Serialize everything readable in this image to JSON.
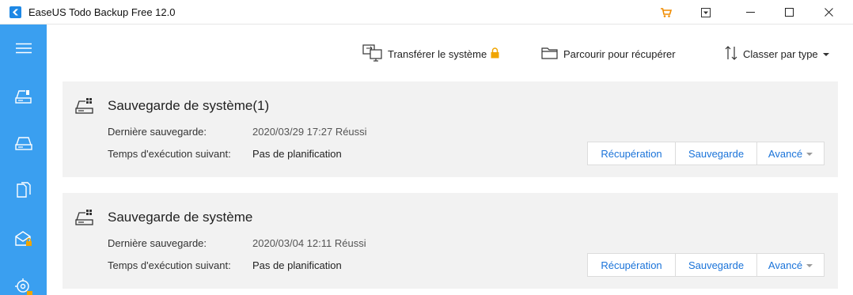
{
  "window": {
    "title": "EaseUS Todo Backup Free 12.0"
  },
  "toolbar": {
    "transfer_label": "Transférer le système",
    "browse_label": "Parcourir pour récupérer",
    "sort_label": "Classer par type"
  },
  "backups": [
    {
      "title": "Sauvegarde de système(1)",
      "last_backup_label": "Dernière sauvegarde:",
      "last_backup_value": "2020/03/29 17:27 Réussi",
      "next_run_label": "Temps d'exécution suivant:",
      "next_run_value": "Pas de planification",
      "recover_label": "Récupération",
      "backup_label": "Sauvegarde",
      "advanced_label": "Avancé"
    },
    {
      "title": "Sauvegarde de système",
      "last_backup_label": "Dernière sauvegarde:",
      "last_backup_value": "2020/03/04 12:11 Réussi",
      "next_run_label": "Temps d'exécution suivant:",
      "next_run_value": "Pas de planification",
      "recover_label": "Récupération",
      "backup_label": "Sauvegarde",
      "advanced_label": "Avancé"
    }
  ],
  "sidebar": {
    "items": [
      "menu-icon",
      "disk-backup-icon",
      "system-backup-icon",
      "file-backup-icon",
      "mail-backup-icon",
      "smart-backup-icon"
    ]
  },
  "colors": {
    "sidebar": "#3a9ff0",
    "accent_link": "#1a73d9",
    "card_bg": "#f2f2f2",
    "lock": "#f0a500",
    "cart": "#f08c00"
  }
}
